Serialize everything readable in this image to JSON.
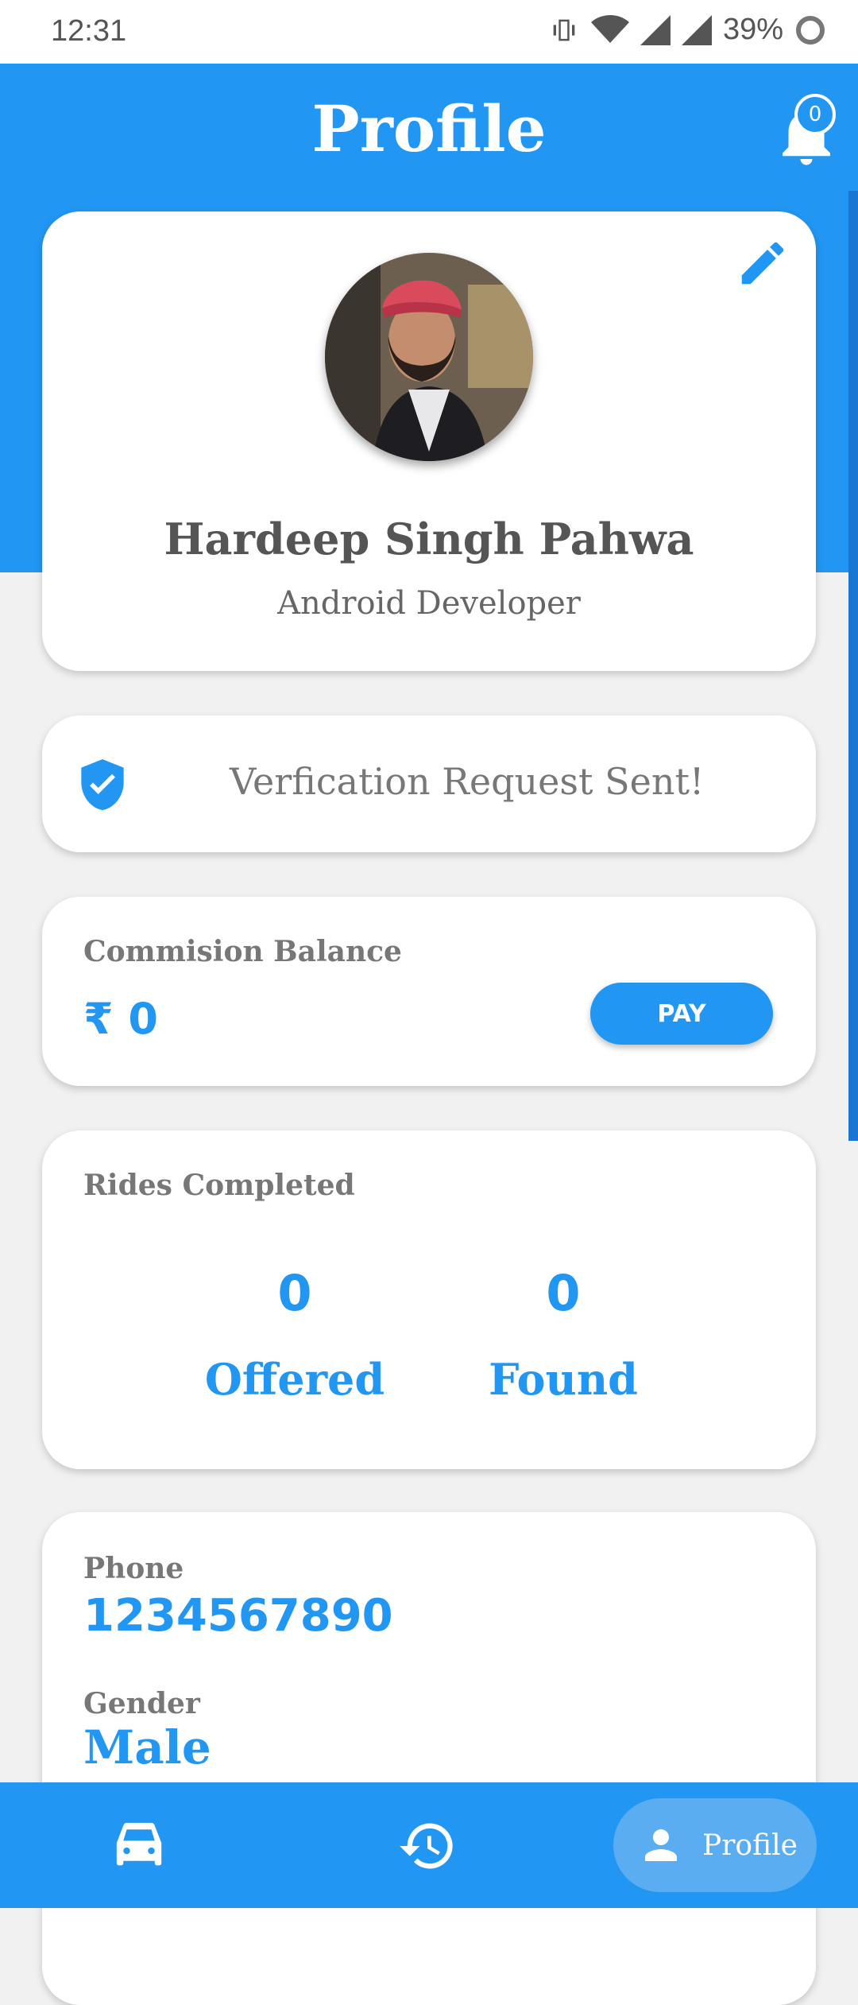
{
  "status_bar": {
    "time": "12:31",
    "battery": "39%"
  },
  "header": {
    "title": "Profile",
    "notification_count": "0"
  },
  "profile": {
    "name": "Hardeep Singh Pahwa",
    "role": "Android Developer"
  },
  "verification": {
    "text": "Verfication Request Sent!"
  },
  "balance": {
    "label": "Commision Balance",
    "value": "₹ 0",
    "pay_label": "PAY"
  },
  "rides": {
    "label": "Rides Completed",
    "offered_count": "0",
    "offered_label": "Offered",
    "found_count": "0",
    "found_label": "Found"
  },
  "info": {
    "phone_label": "Phone",
    "phone_value": "1234567890",
    "gender_label": "Gender",
    "gender_value": "Male"
  },
  "bottom_nav": {
    "profile_label": "Profile"
  },
  "colors": {
    "primary": "#2196F3",
    "background": "#f1f1f1",
    "card": "#ffffff"
  },
  "icons": [
    "vibrate-icon",
    "wifi-icon",
    "signal-icon",
    "battery-icon",
    "bell-icon",
    "edit-icon",
    "shield-check-icon",
    "car-icon",
    "history-icon",
    "person-icon"
  ]
}
